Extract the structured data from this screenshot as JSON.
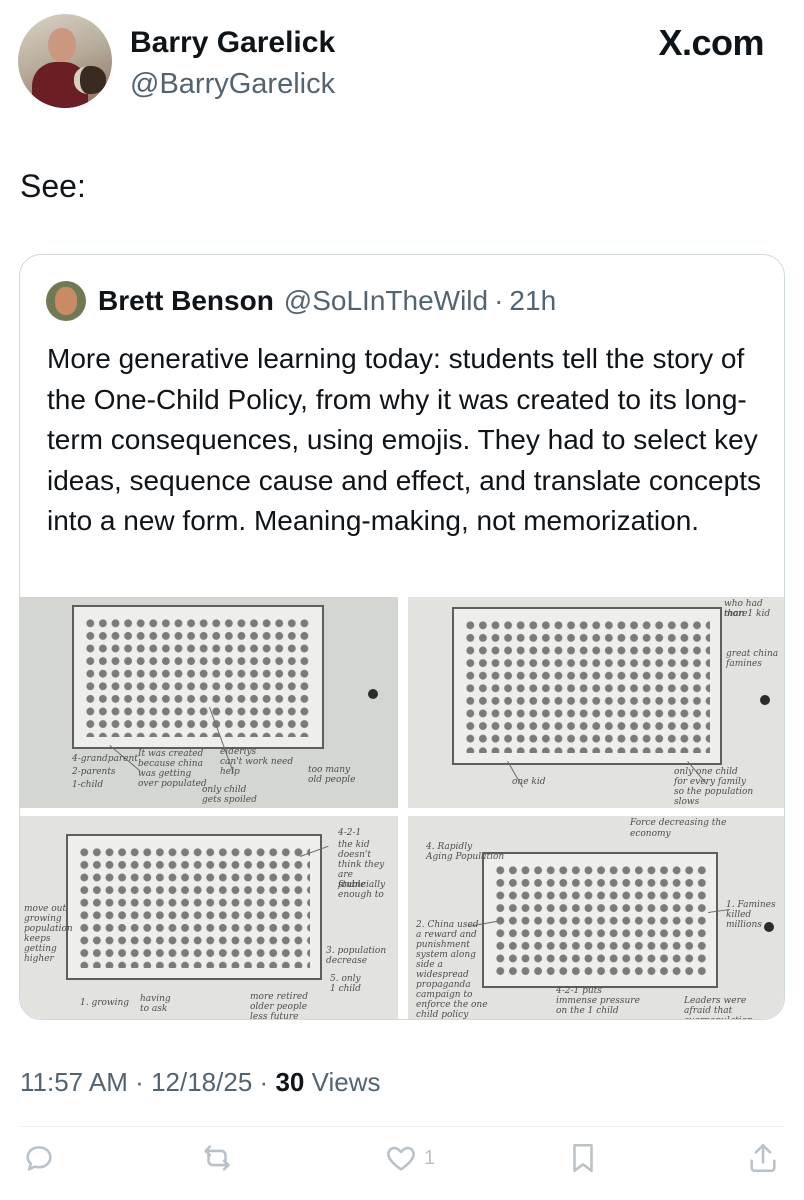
{
  "author": {
    "display_name": "Barry Garelick",
    "handle": "@BarryGarelick"
  },
  "brand": "X.com",
  "post_text": "See:",
  "quoted_post": {
    "display_name": "Brett Benson",
    "handle": "@SoLInTheWild",
    "separator": "·",
    "time": "21h",
    "text": "More generative learning today: students tell the story of the One-Child Policy, from why it was created to its long-term consequences, using emojis. They had to select key ideas, sequence cause and effect, and translate concepts into a new form. Meaning-making, not memorization.",
    "photos": [
      {
        "notes": [
          "4-grandparent",
          "2-parents",
          "1-child",
          "It was created",
          "because china",
          "was getting",
          "over populated",
          "elderlys",
          "can't work need",
          "help",
          "only child",
          "gets spoiled",
          "too many",
          "old people"
        ]
      },
      {
        "notes": [
          "who had more",
          "than 1 kid",
          "great china",
          "famines",
          "one kid",
          "only one child",
          "for every family",
          "so the population",
          "slows"
        ]
      },
      {
        "notes": [
          "4-2-1",
          "the kid",
          "doesn't",
          "think they",
          "are financially",
          "stable",
          "enough to",
          "move out",
          "growing",
          "population",
          "keeps",
          "getting",
          "higher",
          "3. population",
          "decrease",
          "5. only",
          "1 child",
          "1. growing",
          "having",
          "to ask",
          "more retired",
          "older people",
          "less future"
        ]
      },
      {
        "notes": [
          "4. Rapidly",
          "Aging Population",
          "Force decreasing the",
          "economy",
          "2. China used",
          "a reward and",
          "punishment",
          "system along",
          "side a",
          "widespread",
          "propaganda",
          "campaign to",
          "enforce the one",
          "child policy",
          "1. Famines",
          "killed millions",
          "4-2-1 puts",
          "immense pressure",
          "on the 1 child",
          "Leaders were",
          "afraid that overpopulation"
        ]
      }
    ]
  },
  "meta": {
    "time": "11:57 AM",
    "separator": "·",
    "date": "12/18/25",
    "views_count": "30",
    "views_label": "Views"
  },
  "actions": {
    "reply_icon": "reply-icon",
    "repost_icon": "repost-icon",
    "like_icon": "heart-icon",
    "like_count": "1",
    "bookmark_icon": "bookmark-icon",
    "share_icon": "share-icon"
  },
  "colors": {
    "text": "#0f1419",
    "secondary": "#536471",
    "border": "#cfd9de",
    "icon": "#b9c2c9"
  }
}
